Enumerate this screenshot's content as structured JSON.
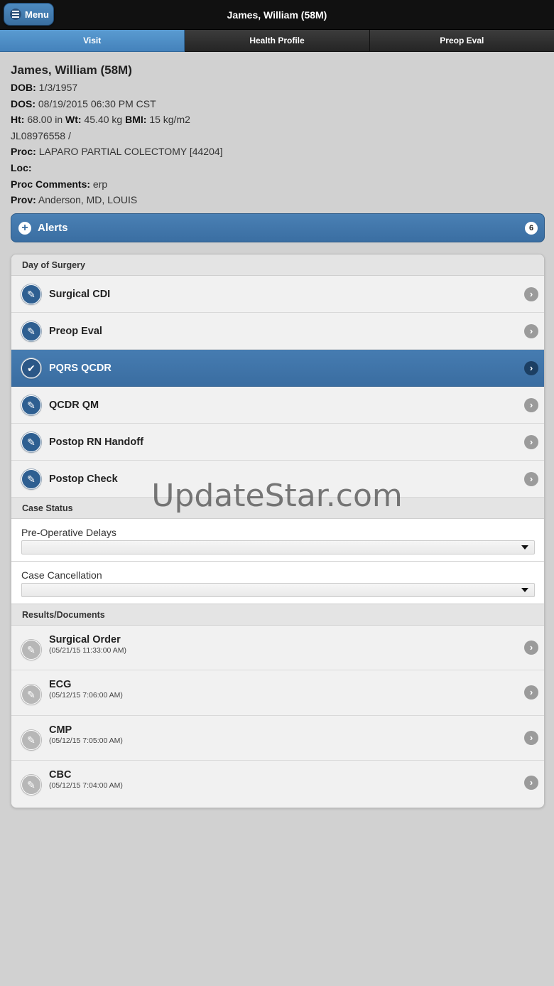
{
  "header": {
    "menu_label": "Menu",
    "title": "James, William (58M)"
  },
  "tabs": [
    {
      "label": "Visit",
      "active": true
    },
    {
      "label": "Health Profile",
      "active": false
    },
    {
      "label": "Preop Eval",
      "active": false
    }
  ],
  "patient": {
    "name": "James, William (58M)",
    "dob_label": "DOB:",
    "dob": "1/3/1957",
    "dos_label": "DOS:",
    "dos": "08/19/2015 06:30 PM CST",
    "ht_label": "Ht:",
    "ht": "68.00 in",
    "wt_label": "Wt:",
    "wt": "45.40 kg",
    "bmi_label": "BMI:",
    "bmi": "15 kg/m2",
    "mrn": "JL08976558 /",
    "proc_label": "Proc:",
    "proc": "LAPARO PARTIAL COLECTOMY [44204]",
    "loc_label": "Loc:",
    "loc": "",
    "proc_comments_label": "Proc Comments:",
    "proc_comments": "erp",
    "prov_label": "Prov:",
    "prov": "Anderson, MD, LOUIS"
  },
  "alerts": {
    "label": "Alerts",
    "count": "6"
  },
  "day_of_surgery": {
    "label": "Day of Surgery",
    "items": [
      {
        "label": "Surgical CDI",
        "icon": "pencil-icon",
        "active": false
      },
      {
        "label": "Preop Eval",
        "icon": "pencil-icon",
        "active": false
      },
      {
        "label": "PQRS QCDR",
        "icon": "check-icon",
        "active": true
      },
      {
        "label": "QCDR QM",
        "icon": "pencil-icon",
        "active": false
      },
      {
        "label": "Postop RN Handoff",
        "icon": "pencil-icon",
        "active": false
      },
      {
        "label": "Postop Check",
        "icon": "pencil-icon",
        "active": false
      }
    ]
  },
  "case_status": {
    "label": "Case Status",
    "pre_op_delays_label": "Pre-Operative Delays",
    "pre_op_delays_value": "",
    "case_cancellation_label": "Case Cancellation",
    "case_cancellation_value": ""
  },
  "results": {
    "label": "Results/Documents",
    "items": [
      {
        "title": "Surgical Order",
        "date": "(05/21/15 11:33:00 AM)"
      },
      {
        "title": "ECG",
        "date": "(05/12/15 7:06:00 AM)"
      },
      {
        "title": "CMP",
        "date": "(05/12/15 7:05:00 AM)"
      },
      {
        "title": "CBC",
        "date": "(05/12/15 7:04:00 AM)"
      }
    ]
  },
  "watermark": "UpdateStar.com",
  "colors": {
    "accent": "#3a6ea2",
    "header_bg": "#111111",
    "tab_active": "#4e8ec6"
  }
}
